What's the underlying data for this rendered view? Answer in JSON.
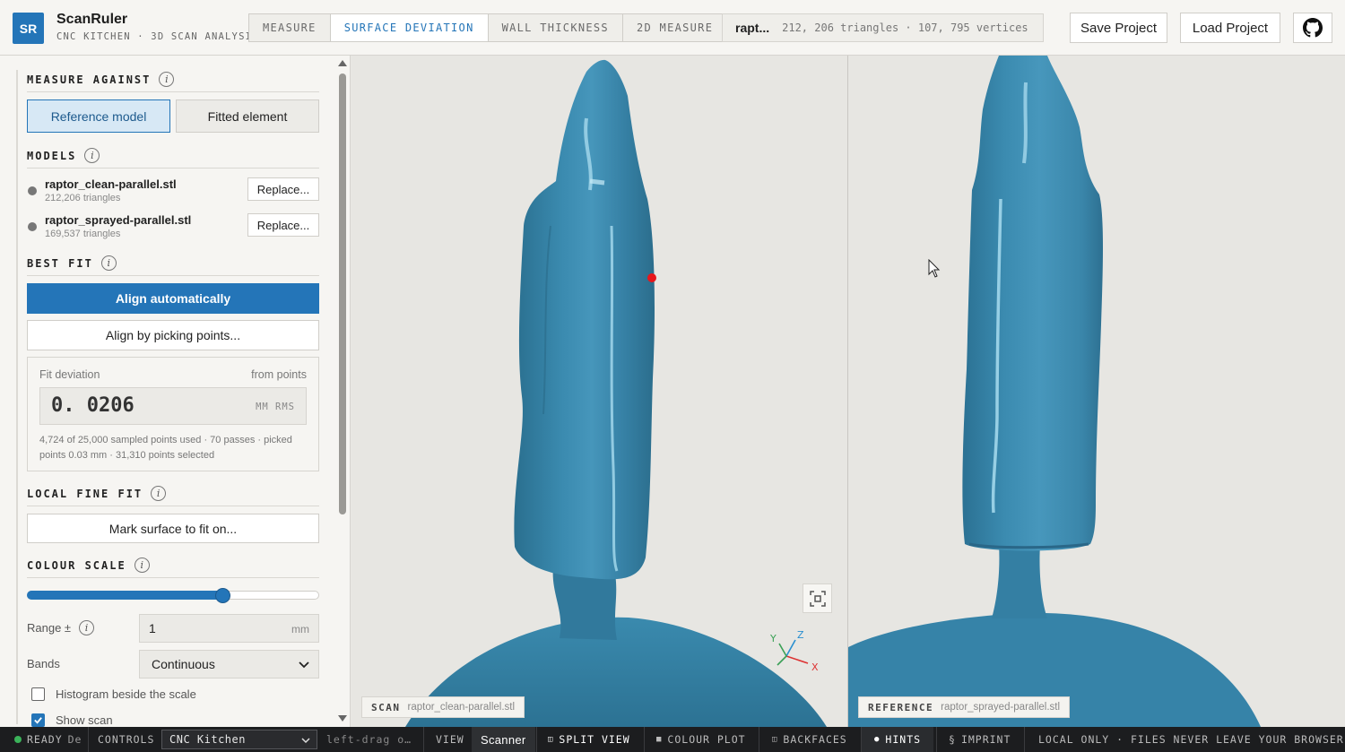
{
  "header": {
    "logo": "SR",
    "title": "ScanRuler",
    "subtitle": "CNC KITCHEN · 3D SCAN ANALYSIS",
    "tabs": [
      {
        "label": "MEASURE",
        "active": false
      },
      {
        "label": "SURFACE DEVIATION",
        "active": true
      },
      {
        "label": "WALL THICKNESS",
        "active": false
      },
      {
        "label": "2D MEASURE",
        "active": false
      }
    ],
    "file_name": "rapt...",
    "file_stats": "212, 206 triangles · 107, 795 vertices",
    "save_label": "Save Project",
    "load_label": "Load Project",
    "github_icon": "github-icon"
  },
  "sidebar": {
    "measure_against": {
      "heading": "MEASURE AGAINST",
      "options": [
        "Reference model",
        "Fitted element"
      ],
      "selected": "Reference model"
    },
    "models": {
      "heading": "MODELS",
      "items": [
        {
          "name": "raptor_clean-parallel.stl",
          "triangles": "212,206 triangles",
          "button": "Replace..."
        },
        {
          "name": "raptor_sprayed-parallel.stl",
          "triangles": "169,537 triangles",
          "button": "Replace..."
        }
      ]
    },
    "best_fit": {
      "heading": "BEST FIT",
      "align_auto": "Align automatically",
      "align_pick": "Align by picking points...",
      "fit_label": "Fit deviation",
      "fit_source": "from points",
      "fit_value": "0. 0206",
      "fit_unit": "MM RMS",
      "fit_note": "4,724 of 25,000 sampled points used · 70 passes · picked points 0.03 mm · 31,310 points selected"
    },
    "local_fine_fit": {
      "heading": "LOCAL FINE FIT",
      "button": "Mark surface to fit on..."
    },
    "colour_scale": {
      "heading": "COLOUR SCALE",
      "slider_fraction": 0.67,
      "range_label": "Range ±",
      "range_value": "1",
      "range_unit": "mm",
      "bands_label": "Bands",
      "bands_value": "Continuous",
      "histogram_label": "Histogram beside the scale",
      "histogram_checked": false,
      "show_scan_label": "Show scan",
      "show_scan_checked": true
    }
  },
  "viewports": {
    "scan": {
      "tag": "SCAN",
      "file": "raptor_clean-parallel.stl"
    },
    "reference": {
      "tag": "REFERENCE",
      "file": "raptor_sprayed-parallel.stl"
    },
    "axis_labels": {
      "x": "X",
      "y": "Y",
      "z": "Z"
    },
    "model_color": "#3d8db0"
  },
  "statusbar": {
    "ready": "READY",
    "ready_extra": "De",
    "controls_label": "CONTROLS",
    "controls_value": "CNC Kitchen",
    "hint": "left-drag o…",
    "view_label": "VIEW",
    "view_value": "Scanner",
    "split_view": "SPLIT VIEW",
    "colour_plot": "COLOUR PLOT",
    "backfaces": "BACKFACES",
    "hints": "HINTS",
    "imprint": "IMPRINT",
    "local_only": "LOCAL ONLY · FILES NEVER LEAVE YOUR BROWSER"
  }
}
